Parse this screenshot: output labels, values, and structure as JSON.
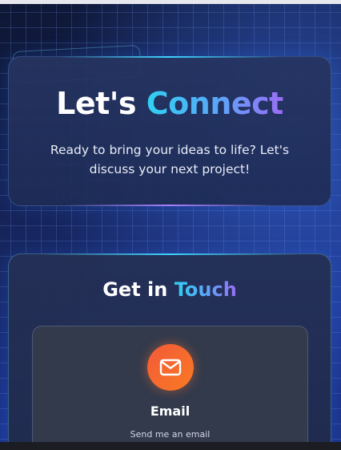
{
  "hero": {
    "title_plain": "Let's ",
    "title_accent": "Connect",
    "subtitle": "Ready to bring your ideas to life? Let's discuss your next project!"
  },
  "contact": {
    "title_plain": "Get in ",
    "title_accent": "Touch",
    "method": {
      "icon": "mail-icon",
      "name": "Email",
      "description": "Send me an email"
    }
  },
  "colors": {
    "accent_cyan": "#2fd0f2",
    "accent_purple": "#9a6cf6",
    "email_icon_orange": "#f25a3a"
  }
}
